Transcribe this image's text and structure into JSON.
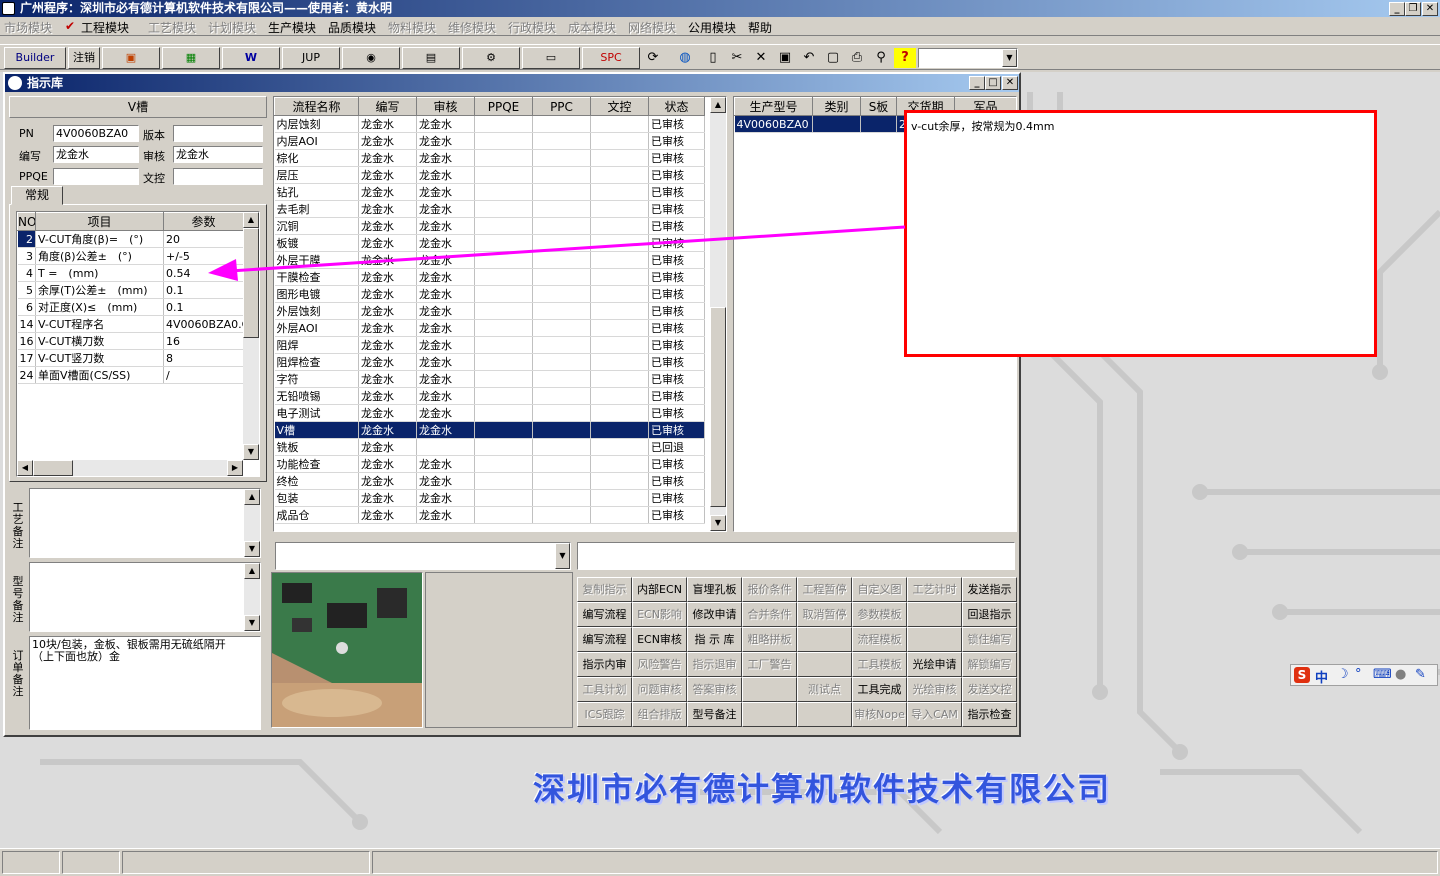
{
  "app_title": "广州程序：深圳市必有德计算机软件技术有限公司——使用者：黄水明",
  "menu": [
    {
      "label": "市场模块",
      "enabled": false
    },
    {
      "label": "工程模块",
      "enabled": true,
      "checked": true
    },
    {
      "label": "工艺模块",
      "enabled": false
    },
    {
      "label": "计划模块",
      "enabled": false
    },
    {
      "label": "生产模块",
      "enabled": true
    },
    {
      "label": "品质模块",
      "enabled": true
    },
    {
      "label": "物料模块",
      "enabled": false
    },
    {
      "label": "维修模块",
      "enabled": false
    },
    {
      "label": "行政模块",
      "enabled": false
    },
    {
      "label": "成本模块",
      "enabled": false
    },
    {
      "label": "网络模块",
      "enabled": false
    },
    {
      "label": "公用模块",
      "enabled": true
    },
    {
      "label": "帮助",
      "enabled": true
    }
  ],
  "toolbar": {
    "builder": "Builder",
    "logout": "注销",
    "jup": "JUP",
    "spc": "SPC"
  },
  "window_title": "指示库",
  "left": {
    "header": "V槽",
    "pn_label": "PN",
    "pn_value": "4V0060BZA0",
    "version_label": "版本",
    "version_value": "",
    "author_label": "编写",
    "author_value": "龙金水",
    "review_label": "审核",
    "review_value": "龙金水",
    "ppqe_label": "PPQE",
    "ppqe_value": "",
    "doc_label": "文控",
    "doc_value": "",
    "tab": "常规",
    "param_headers": [
      "NO",
      "项目",
      "参数"
    ],
    "params": [
      {
        "no": "2",
        "item": "V-CUT角度(β)=　(°)",
        "value": "20"
      },
      {
        "no": "3",
        "item": "角度(β)公差±　(°)",
        "value": "+/-5"
      },
      {
        "no": "4",
        "item": "T =　(mm)",
        "value": "0.54"
      },
      {
        "no": "5",
        "item": "余厚(T)公差±　(mm)",
        "value": "0.1"
      },
      {
        "no": "6",
        "item": "对正度(X)≤　(mm)",
        "value": "0.1"
      },
      {
        "no": "14",
        "item": "V-CUT程序名",
        "value": "4V0060BZA0.CS"
      },
      {
        "no": "16",
        "item": "V-CUT横刀数",
        "value": "16"
      },
      {
        "no": "17",
        "item": "V-CUT竖刀数",
        "value": "8"
      },
      {
        "no": "24",
        "item": "单面V槽面(CS/SS)",
        "value": "/"
      }
    ],
    "notes": [
      {
        "label": "工艺备注",
        "text": ""
      },
      {
        "label": "型号备注",
        "text": ""
      },
      {
        "label": "订单备注",
        "text": "10块/包装，金板、银板需用无硫纸隔开（上下面也放）金"
      }
    ]
  },
  "process": {
    "headers": [
      "流程名称",
      "编写",
      "审核",
      "PPQE",
      "PPC",
      "文控",
      "状态"
    ],
    "rows": [
      [
        "内层蚀刻",
        "龙金水",
        "龙金水",
        "",
        "",
        "",
        "已审核"
      ],
      [
        "内层AOI",
        "龙金水",
        "龙金水",
        "",
        "",
        "",
        "已审核"
      ],
      [
        "棕化",
        "龙金水",
        "龙金水",
        "",
        "",
        "",
        "已审核"
      ],
      [
        "层压",
        "龙金水",
        "龙金水",
        "",
        "",
        "",
        "已审核"
      ],
      [
        "钻孔",
        "龙金水",
        "龙金水",
        "",
        "",
        "",
        "已审核"
      ],
      [
        "去毛刺",
        "龙金水",
        "龙金水",
        "",
        "",
        "",
        "已审核"
      ],
      [
        "沉铜",
        "龙金水",
        "龙金水",
        "",
        "",
        "",
        "已审核"
      ],
      [
        "板镀",
        "龙金水",
        "龙金水",
        "",
        "",
        "",
        "已审核"
      ],
      [
        "外层干膜",
        "龙金水",
        "龙金水",
        "",
        "",
        "",
        "已审核"
      ],
      [
        "干膜检查",
        "龙金水",
        "龙金水",
        "",
        "",
        "",
        "已审核"
      ],
      [
        "图形电镀",
        "龙金水",
        "龙金水",
        "",
        "",
        "",
        "已审核"
      ],
      [
        "外层蚀刻",
        "龙金水",
        "龙金水",
        "",
        "",
        "",
        "已审核"
      ],
      [
        "外层AOI",
        "龙金水",
        "龙金水",
        "",
        "",
        "",
        "已审核"
      ],
      [
        "阻焊",
        "龙金水",
        "龙金水",
        "",
        "",
        "",
        "已审核"
      ],
      [
        "阻焊检查",
        "龙金水",
        "龙金水",
        "",
        "",
        "",
        "已审核"
      ],
      [
        "字符",
        "龙金水",
        "龙金水",
        "",
        "",
        "",
        "已审核"
      ],
      [
        "无铅喷锡",
        "龙金水",
        "龙金水",
        "",
        "",
        "",
        "已审核"
      ],
      [
        "电子测试",
        "龙金水",
        "龙金水",
        "",
        "",
        "",
        "已审核"
      ],
      [
        "V槽",
        "龙金水",
        "龙金水",
        "",
        "",
        "",
        "已审核"
      ],
      [
        "铣板",
        "龙金水",
        "",
        "",
        "",
        "",
        "已回退"
      ],
      [
        "功能检查",
        "龙金水",
        "龙金水",
        "",
        "",
        "",
        "已审核"
      ],
      [
        "终检",
        "龙金水",
        "龙金水",
        "",
        "",
        "",
        "已审核"
      ],
      [
        "包装",
        "龙金水",
        "龙金水",
        "",
        "",
        "",
        "已审核"
      ],
      [
        "成品仓",
        "龙金水",
        "龙金水",
        "",
        "",
        "",
        "已审核"
      ]
    ],
    "selected_index": 18
  },
  "production": {
    "headers": [
      "生产型号",
      "类别",
      "S板",
      "交货期",
      "军品"
    ],
    "rows": [
      [
        "4V0060BZA0",
        "",
        "",
        "20",
        ""
      ]
    ]
  },
  "annotation": {
    "text": "v-cut余厚，按常规为0.4mm",
    "color": "#ff00ff",
    "box_color": "#ff0000"
  },
  "buttons": [
    [
      {
        "label": "复制指示",
        "enabled": false
      },
      {
        "label": "内部ECN",
        "enabled": true
      },
      {
        "label": "盲埋孔板",
        "enabled": true
      },
      {
        "label": "报价条件",
        "enabled": false
      },
      {
        "label": "工程暂停",
        "enabled": false
      },
      {
        "label": "自定义图",
        "enabled": false
      },
      {
        "label": "工艺计时",
        "enabled": false
      },
      {
        "label": "发送指示",
        "enabled": true
      }
    ],
    [
      {
        "label": "编写流程",
        "enabled": true
      },
      {
        "label": "ECN影响",
        "enabled": false
      },
      {
        "label": "修改申请",
        "enabled": true
      },
      {
        "label": "合并条件",
        "enabled": false
      },
      {
        "label": "取消暂停",
        "enabled": false
      },
      {
        "label": "参数模板",
        "enabled": false
      },
      {
        "label": "",
        "enabled": false
      },
      {
        "label": "回退指示",
        "enabled": true
      }
    ],
    [
      {
        "label": "编写流程",
        "enabled": true
      },
      {
        "label": "ECN审核",
        "enabled": true
      },
      {
        "label": "指 示 库",
        "enabled": true
      },
      {
        "label": "粗略拼板",
        "enabled": false
      },
      {
        "label": "",
        "enabled": false
      },
      {
        "label": "流程模板",
        "enabled": false
      },
      {
        "label": "",
        "enabled": false
      },
      {
        "label": "锁住编写",
        "enabled": false
      }
    ],
    [
      {
        "label": "指示内审",
        "enabled": true
      },
      {
        "label": "风险警告",
        "enabled": false
      },
      {
        "label": "指示退审",
        "enabled": false
      },
      {
        "label": "工厂警告",
        "enabled": false
      },
      {
        "label": "",
        "enabled": false
      },
      {
        "label": "工具模板",
        "enabled": false
      },
      {
        "label": "光绘申请",
        "enabled": true
      },
      {
        "label": "解锁编写",
        "enabled": false
      }
    ],
    [
      {
        "label": "工具计划",
        "enabled": false
      },
      {
        "label": "问题审核",
        "enabled": false
      },
      {
        "label": "答案审核",
        "enabled": false
      },
      {
        "label": "",
        "enabled": false
      },
      {
        "label": "测试点",
        "enabled": false
      },
      {
        "label": "工具完成",
        "enabled": true
      },
      {
        "label": "光绘审核",
        "enabled": false
      },
      {
        "label": "发送文控",
        "enabled": false
      }
    ],
    [
      {
        "label": "ICS跟踪",
        "enabled": false
      },
      {
        "label": "组合排版",
        "enabled": false
      },
      {
        "label": "型号备注",
        "enabled": true
      },
      {
        "label": "",
        "enabled": false
      },
      {
        "label": "",
        "enabled": false
      },
      {
        "label": "审核Nope",
        "enabled": false
      },
      {
        "label": "导入CAM",
        "enabled": false
      },
      {
        "label": "指示检查",
        "enabled": true
      }
    ]
  ],
  "company_banner": "深圳市必有德计算机软件技术有限公司",
  "ime": {
    "logo": "S",
    "lang": "中"
  }
}
